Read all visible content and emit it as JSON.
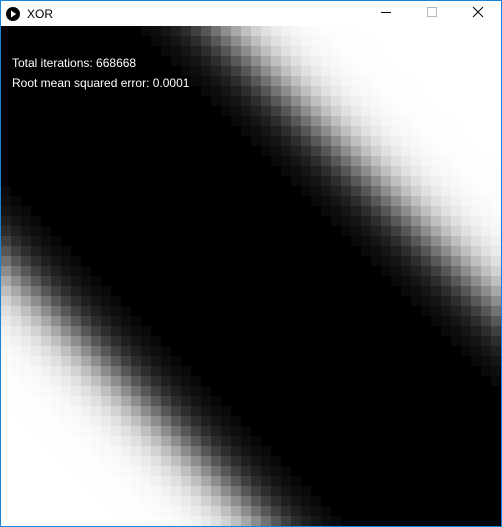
{
  "window": {
    "title": "XOR",
    "icons": {
      "app": "play-circle-icon",
      "minimize": "minimize-icon",
      "maximize": "maximize-icon",
      "close": "close-icon"
    },
    "accent_color": "#1883d7"
  },
  "overlay": {
    "iterations_text": "Total iterations: 668668",
    "rmse_text": "Root mean squared error: 0.0001"
  },
  "colors": {
    "background": "#000000",
    "foreground": "#ffffff"
  }
}
